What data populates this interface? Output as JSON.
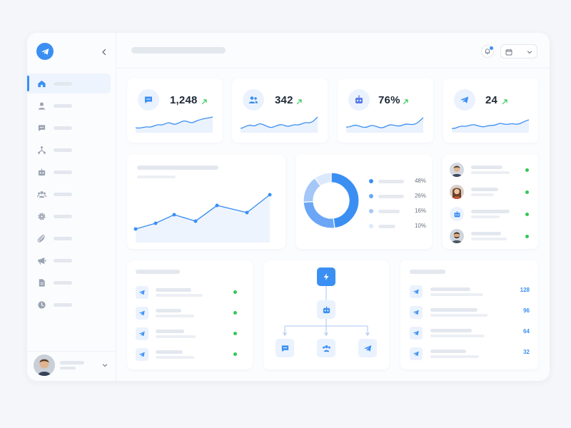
{
  "colors": {
    "accent": "#3b8ff3",
    "accent_light": "#eaf2fe",
    "status_online": "#34c759",
    "trend_up": "#34c759"
  },
  "sidebar": {
    "logo_icon": "telegram-paper-plane-icon",
    "collapse_icon": "chevron-left-icon",
    "items": [
      {
        "icon": "home-icon",
        "active": true
      },
      {
        "icon": "user-icon"
      },
      {
        "icon": "chat-icon"
      },
      {
        "icon": "flow-icon"
      },
      {
        "icon": "bot-icon"
      },
      {
        "icon": "users-icon"
      },
      {
        "icon": "gear-icon"
      },
      {
        "icon": "paperclip-icon"
      },
      {
        "icon": "megaphone-icon"
      },
      {
        "icon": "document-icon"
      },
      {
        "icon": "clock-icon"
      }
    ]
  },
  "topbar": {
    "bell_icon": "bell-icon",
    "calendar_icon": "calendar-icon",
    "dropdown_icon": "chevron-down-icon"
  },
  "stats": [
    {
      "icon": "chat-icon",
      "value": "1,248",
      "trend": "up"
    },
    {
      "icon": "users-icon",
      "value": "342",
      "trend": "up"
    },
    {
      "icon": "bot-icon",
      "value": "76%",
      "trend": "up"
    },
    {
      "icon": "paper-plane-icon",
      "value": "24",
      "trend": "up"
    }
  ],
  "chart_data": {
    "type": "pie",
    "values": [
      48,
      26,
      16,
      10
    ],
    "labels": [
      "48%",
      "26%",
      "16%",
      "10%"
    ],
    "colors": [
      "#3b8ff3",
      "#6aa6f5",
      "#a4c7f8",
      "#dce9fc"
    ]
  },
  "legend": [
    "48%",
    "26%",
    "16%",
    "10%"
  ],
  "contacts": [
    {
      "avatar": "man-avatar"
    },
    {
      "avatar": "woman-avatar"
    },
    {
      "avatar": "bot-icon"
    },
    {
      "avatar": "man-beard-avatar"
    }
  ],
  "flow": {
    "trigger_icon": "lightning-icon",
    "bot_icon": "bot-icon",
    "branches": [
      "chat-icon",
      "users-icon",
      "paper-plane-icon"
    ]
  },
  "stats_list": [
    "128",
    "96",
    "64",
    "32"
  ]
}
